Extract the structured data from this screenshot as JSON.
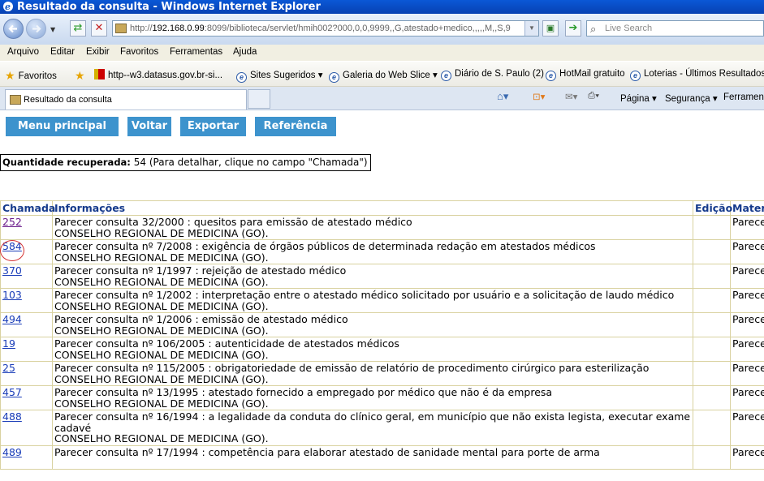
{
  "window": {
    "title": "Resultado da consulta - Windows Internet Explorer"
  },
  "address": {
    "url_prefix": "http://",
    "url_host": "192.168.0.99",
    "url_rest": ":8099/biblioteca/servlet/hmih002?000,0,0,9999,,G,atestado+medico,,,,,M,,S,9",
    "search_placeholder": "Live Search"
  },
  "menu": [
    "Arquivo",
    "Editar",
    "Exibir",
    "Favoritos",
    "Ferramentas",
    "Ajuda"
  ],
  "favorites": {
    "label": "Favoritos",
    "items": [
      "http--w3.datasus.gov.br-si...",
      "Sites Sugeridos ▾",
      "Galeria do Web Slice ▾",
      "Diário de S. Paulo (2)",
      "HotMail gratuito",
      "Loterias - Últimos Resultados"
    ]
  },
  "tab": {
    "title": "Resultado da consulta"
  },
  "commandbar": {
    "page": "Página ▾",
    "security": "Segurança ▾",
    "tools": "Ferramentas"
  },
  "buttons": {
    "main_menu": "Menu principal",
    "back": "Voltar",
    "export": "Exportar",
    "reference": "Referência"
  },
  "quantity": {
    "label": "Quantidade recuperada:",
    "value": "54",
    "note": "(Para detalhar, clique no campo \"Chamada\")"
  },
  "table": {
    "headers": {
      "chamada": "Chamada",
      "informacoes": "Informações",
      "edicao": "Edição",
      "material": "Material"
    },
    "rows": [
      {
        "chamada": "252",
        "title": "Parecer consulta 32/2000 : quesitos para emissão de atestado médico",
        "author": "CONSELHO REGIONAL DE MEDICINA (GO).",
        "material": "Parecer consulta"
      },
      {
        "chamada": "584",
        "title": "Parecer consulta nº 7/2008 : exigência de órgãos públicos de determinada redação em atestados médicos",
        "author": "CONSELHO REGIONAL DE MEDICINA (GO).",
        "material": "Parecer consulta"
      },
      {
        "chamada": "370",
        "title": "Parecer consulta nº 1/1997 : rejeição de atestado médico",
        "author": "CONSELHO REGIONAL DE MEDICINA (GO).",
        "material": "Parecer consulta"
      },
      {
        "chamada": "103",
        "title": "Parecer consulta nº 1/2002 : interpretação entre o atestado médico solicitado por usuário e a solicitação de laudo médico",
        "author": "CONSELHO REGIONAL DE MEDICINA (GO).",
        "material": "Parecer consulta"
      },
      {
        "chamada": "494",
        "title": "Parecer consulta nº 1/2006 : emissão de atestado médico",
        "author": "CONSELHO REGIONAL DE MEDICINA (GO).",
        "material": "Parecer consulta"
      },
      {
        "chamada": "19",
        "title": "Parecer consulta nº 106/2005 : autenticidade de atestados médicos",
        "author": "CONSELHO REGIONAL DE MEDICINA (GO).",
        "material": "Parecer consulta"
      },
      {
        "chamada": "25",
        "title": "Parecer consulta nº 115/2005 : obrigatoriedade de emissão de relatório de procedimento cirúrgico para esterilização",
        "author": "CONSELHO REGIONAL DE MEDICINA (GO).",
        "material": "Parecer consulta"
      },
      {
        "chamada": "457",
        "title": "Parecer consulta nº 13/1995 : atestado fornecido a empregado por médico que não é da empresa",
        "author": "CONSELHO REGIONAL DE MEDICINA (GO).",
        "material": "Parecer consulta"
      },
      {
        "chamada": "488",
        "title": "Parecer consulta nº 16/1994 : a legalidade da conduta do clínico geral, em município que não exista legista, executar exame cadavé",
        "author": "CONSELHO REGIONAL DE MEDICINA (GO).",
        "material": "Parecer consulta"
      },
      {
        "chamada": "489",
        "title": "Parecer consulta nº 17/1994 : competência para elaborar atestado de sanidade mental para porte de arma",
        "author": "",
        "material": "Parecer"
      }
    ]
  }
}
